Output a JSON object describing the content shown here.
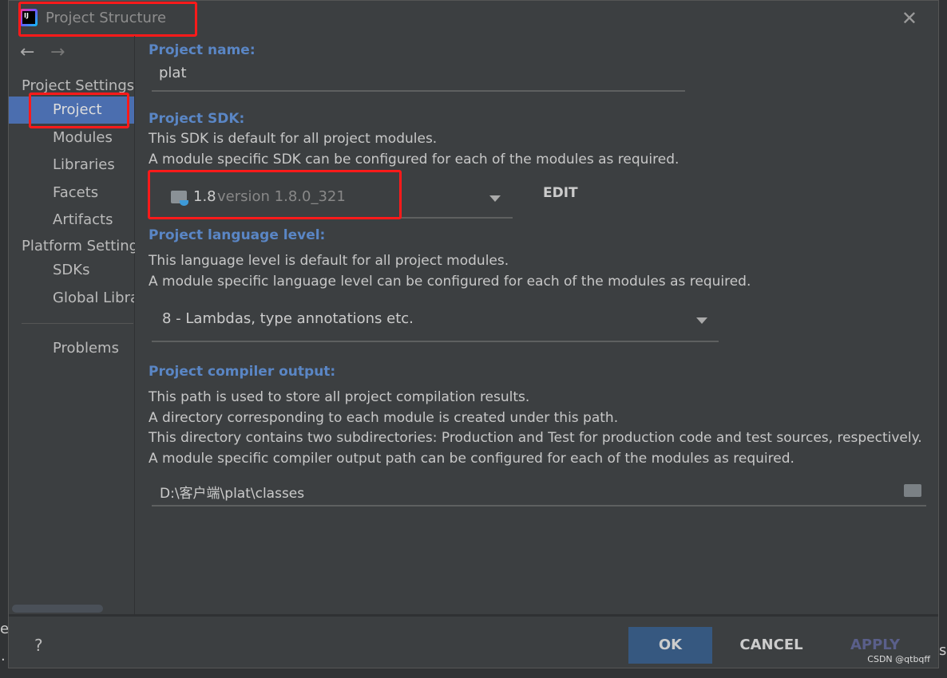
{
  "window": {
    "title": "Project Structure",
    "close_icon": "close-icon"
  },
  "background": {
    "left_chars": [
      "e",
      "."
    ],
    "right_char": "s"
  },
  "sidebar": {
    "sections": [
      {
        "label": "Project Settings",
        "items": [
          "Project",
          "Modules",
          "Libraries",
          "Facets",
          "Artifacts"
        ]
      },
      {
        "label": "Platform Settings",
        "items": [
          "SDKs",
          "Global Libraries"
        ]
      }
    ],
    "problems": "Problems",
    "selected": "Project"
  },
  "main": {
    "name_label": "Project name:",
    "name_value": "plat",
    "sdk_label": "Project SDK:",
    "sdk_desc1": "This SDK is default for all project modules.",
    "sdk_desc2": "A module specific SDK can be configured for each of the modules as required.",
    "sdk_name": "1.8",
    "sdk_version": "version 1.8.0_321",
    "edit_label": "EDIT",
    "lang_label": "Project language level:",
    "lang_desc1": "This language level is default for all project modules.",
    "lang_desc2": "A module specific language level can be configured for each of the modules as required.",
    "lang_value": "8 - Lambdas, type annotations etc.",
    "out_label": "Project compiler output:",
    "out_desc1": "This path is used to store all project compilation results.",
    "out_desc2": "A directory corresponding to each module is created under this path.",
    "out_desc3": "This directory contains two subdirectories: Production and Test for production code and test sources, respectively.",
    "out_desc4": "A module specific compiler output path can be configured for each of the modules as required.",
    "out_value": "D:\\客户端\\plat\\classes"
  },
  "footer": {
    "help": "?",
    "ok": "OK",
    "cancel": "CANCEL",
    "apply": "APPLY",
    "watermark": "CSDN @qtbqff"
  },
  "colors": {
    "accent": "#4b6eaf",
    "label": "#5a86c5",
    "ok_button": "#365880",
    "highlight": "#ff1a1a"
  }
}
